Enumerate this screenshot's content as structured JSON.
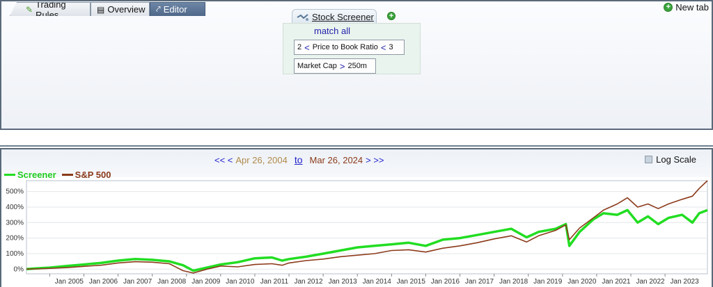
{
  "screener": {
    "tab_label": "Stock Screener",
    "match_label": "match all",
    "rules": [
      {
        "low": "2",
        "op1": "<",
        "field": "Price to Book Ratio",
        "op2": "<",
        "high": "3"
      },
      {
        "field": "Market Cap",
        "op": ">",
        "value": "250m"
      }
    ]
  },
  "tabs": {
    "trading_rules": "Trading Rules",
    "overview": "Overview",
    "editor": "Editor",
    "new_tab": "New tab"
  },
  "date_range": {
    "nav_back": "<< <",
    "start": "Apr 26, 2004",
    "to": "to",
    "end": "Mar 26, 2024",
    "nav_forward": "> >>"
  },
  "log_scale_label": "Log Scale",
  "colors": {
    "screener": "#22dd22",
    "sp500": "#8b3a1a"
  },
  "chart_data": {
    "type": "line",
    "y_tick_labels": [
      "0%",
      "100%",
      "200%",
      "300%",
      "400%",
      "500%"
    ],
    "ylim": [
      -30,
      570
    ],
    "x_tick_labels": [
      "Jan 2005",
      "Jan 2006",
      "Jan 2007",
      "Jan 2008",
      "Jan 2009",
      "Jan 2010",
      "Jan 2011",
      "Jan 2012",
      "Jan 2013",
      "Jan 2014",
      "Jan 2015",
      "Jan 2016",
      "Jan 2017",
      "Jan 2018",
      "Jan 2019",
      "Jan 2020",
      "Jan 2021",
      "Jan 2022",
      "Jan 2023"
    ],
    "xlim": [
      2004.32,
      2024.24
    ],
    "grid": true,
    "legend_position": "top-left",
    "series": [
      {
        "name": "Screener",
        "color": "#22dd22",
        "x": [
          2004.32,
          2004.6,
          2005.0,
          2005.5,
          2006.0,
          2006.5,
          2007.0,
          2007.5,
          2008.0,
          2008.5,
          2008.9,
          2009.2,
          2009.6,
          2010.0,
          2010.5,
          2011.0,
          2011.5,
          2011.8,
          2012.0,
          2012.5,
          2013.0,
          2013.5,
          2014.0,
          2014.5,
          2015.0,
          2015.5,
          2016.0,
          2016.5,
          2017.0,
          2017.5,
          2018.0,
          2018.5,
          2018.95,
          2019.3,
          2019.8,
          2020.1,
          2020.2,
          2020.5,
          2020.9,
          2021.2,
          2021.6,
          2021.9,
          2022.2,
          2022.5,
          2022.8,
          2023.1,
          2023.5,
          2023.8,
          2024.0,
          2024.24
        ],
        "y": [
          0,
          5,
          10,
          20,
          30,
          40,
          55,
          65,
          60,
          50,
          25,
          -10,
          10,
          30,
          45,
          70,
          75,
          55,
          65,
          80,
          100,
          120,
          140,
          150,
          160,
          170,
          150,
          190,
          200,
          220,
          240,
          260,
          205,
          240,
          260,
          290,
          150,
          240,
          320,
          360,
          350,
          380,
          300,
          340,
          290,
          330,
          350,
          300,
          360,
          380
        ]
      },
      {
        "name": "S&P 500",
        "color": "#8b3a1a",
        "x": [
          2004.32,
          2004.6,
          2005.0,
          2005.5,
          2006.0,
          2006.5,
          2007.0,
          2007.5,
          2008.0,
          2008.5,
          2008.9,
          2009.2,
          2009.6,
          2010.0,
          2010.5,
          2011.0,
          2011.5,
          2011.8,
          2012.0,
          2012.5,
          2013.0,
          2013.5,
          2014.0,
          2014.5,
          2015.0,
          2015.5,
          2016.0,
          2016.5,
          2017.0,
          2017.5,
          2018.0,
          2018.5,
          2018.95,
          2019.3,
          2019.8,
          2020.1,
          2020.2,
          2020.5,
          2020.9,
          2021.2,
          2021.6,
          2021.9,
          2022.2,
          2022.5,
          2022.8,
          2023.1,
          2023.5,
          2023.8,
          2024.0,
          2024.24
        ],
        "y": [
          0,
          2,
          5,
          10,
          18,
          25,
          40,
          48,
          45,
          35,
          -10,
          -25,
          0,
          20,
          15,
          30,
          35,
          25,
          40,
          55,
          65,
          80,
          90,
          100,
          120,
          125,
          110,
          135,
          150,
          170,
          195,
          215,
          175,
          215,
          250,
          285,
          190,
          265,
          330,
          380,
          420,
          460,
          400,
          420,
          390,
          420,
          450,
          470,
          520,
          570
        ]
      }
    ]
  }
}
